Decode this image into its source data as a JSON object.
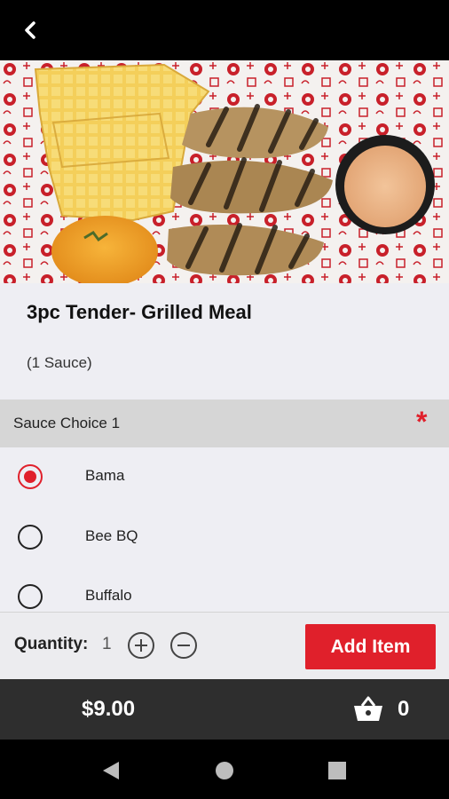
{
  "item": {
    "title": "3pc Tender- Grilled Meal",
    "subtitle": "(1 Sauce)"
  },
  "section": {
    "label": "Sauce Choice 1",
    "required_mark": "*"
  },
  "options": [
    {
      "label": "Bama",
      "selected": true
    },
    {
      "label": "Bee BQ",
      "selected": false
    },
    {
      "label": "Buffalo",
      "selected": false
    }
  ],
  "quantity": {
    "label": "Quantity:",
    "value": "1"
  },
  "add_button": "Add Item",
  "footer": {
    "price": "$9.00",
    "cart_count": "0"
  },
  "colors": {
    "accent": "#e0202b",
    "footer_bg": "#2e2e2e"
  },
  "icons": {
    "back": "chevron-left-icon",
    "increment": "plus-circle-icon",
    "decrement": "minus-circle-icon",
    "cart": "basket-icon",
    "nav_back": "triangle-back-icon",
    "nav_home": "circle-home-icon",
    "nav_recent": "square-recent-icon"
  }
}
